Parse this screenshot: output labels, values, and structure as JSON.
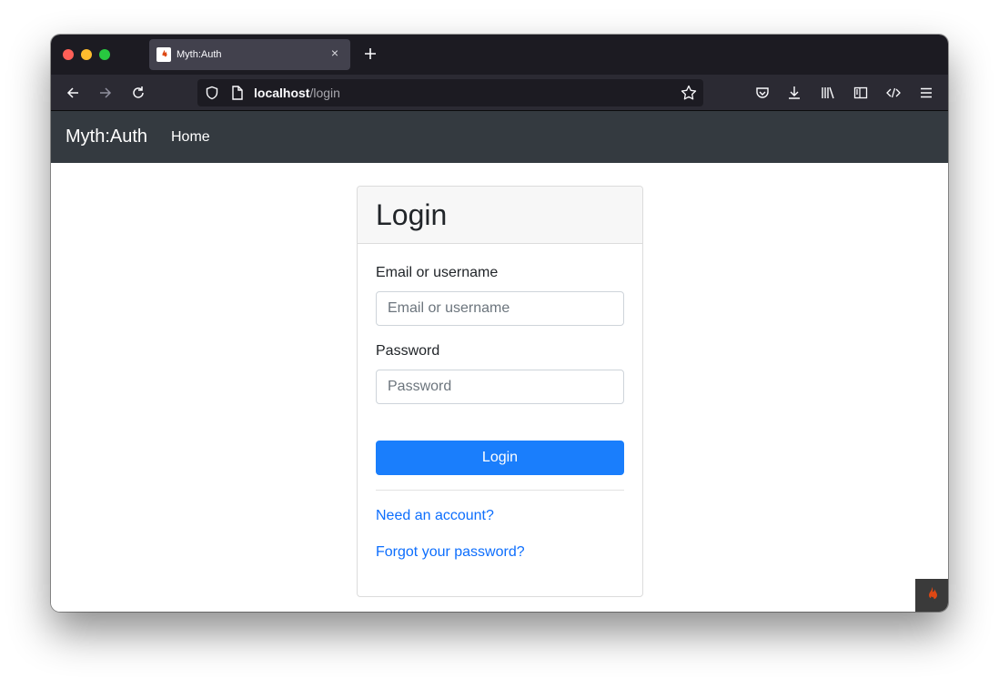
{
  "browser": {
    "tab": {
      "title": "Myth:Auth",
      "close_glyph": "×"
    },
    "new_tab_glyph": "+",
    "url": {
      "host": "localhost",
      "path": "/login"
    },
    "icons": [
      "back-icon",
      "forward-icon",
      "reload-icon",
      "shield-icon",
      "page-icon",
      "star-icon",
      "pocket-icon",
      "download-icon",
      "library-icon",
      "sidebar-icon",
      "devtools-icon",
      "menu-icon"
    ]
  },
  "site": {
    "brand": "Myth:Auth",
    "nav": {
      "home": "Home"
    }
  },
  "login": {
    "title": "Login",
    "email_label": "Email or username",
    "email_placeholder": "Email or username",
    "email_value": "",
    "password_label": "Password",
    "password_placeholder": "Password",
    "password_value": "",
    "submit_label": "Login",
    "register_link": "Need an account?",
    "forgot_link": "Forgot your password?"
  },
  "colors": {
    "navbar": "#343a40",
    "primary": "#1a7efc",
    "link": "#0d6efd",
    "codeigniter": "#dd4814"
  }
}
